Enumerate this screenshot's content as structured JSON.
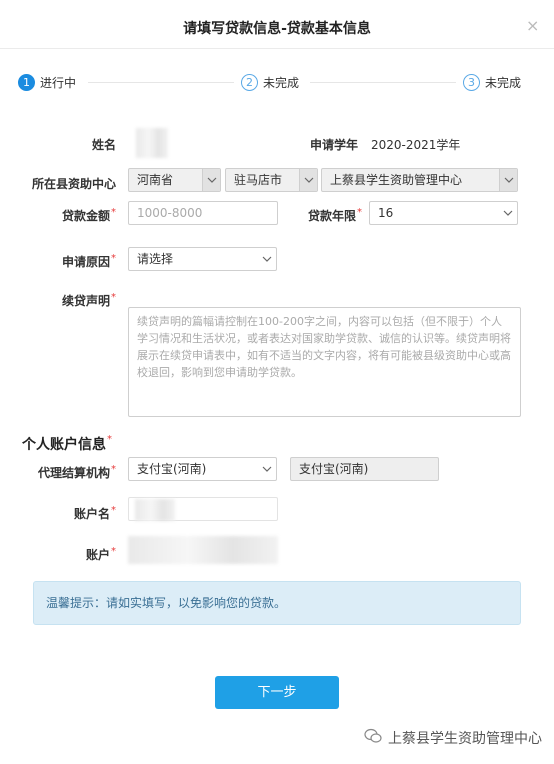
{
  "dialog": {
    "title": "请填写贷款信息-贷款基本信息",
    "close_symbol": "×"
  },
  "steps": [
    {
      "num": "1",
      "label": "进行中"
    },
    {
      "num": "2",
      "label": "未完成"
    },
    {
      "num": "3",
      "label": "未完成"
    }
  ],
  "form": {
    "name_label": "姓名",
    "year_label": "申请学年",
    "year_value": "2020-2021学年",
    "center_label": "所在县资助中心",
    "province": "河南省",
    "city": "驻马店市",
    "center": "上蔡县学生资助管理中心",
    "amount_label": "贷款金额",
    "amount_placeholder": "1000-8000",
    "term_label": "贷款年限",
    "term_value": "16",
    "reason_label": "申请原因",
    "reason_value": "请选择",
    "statement_label": "续贷声明",
    "statement_placeholder": "续贷声明的篇幅请控制在100-200字之间，内容可以包括（但不限于）个人学习情况和生活状况，或者表达对国家助学贷款、诚信的认识等。续贷声明将展示在续贷申请表中，如有不适当的文字内容，将有可能被县级资助中心或高校退回，影响到您申请助学贷款。",
    "required_mark": "*"
  },
  "account": {
    "section_title": "个人账户信息",
    "agency_label": "代理结算机构",
    "agency_value": "支付宝(河南)",
    "agency_display": "支付宝(河南)",
    "account_name_label": "账户名",
    "account_label": "账户"
  },
  "tip": {
    "text": "温馨提示：请如实填写，以免影响您的贷款。"
  },
  "buttons": {
    "next": "下一步"
  },
  "watermark": {
    "text": "上蔡县学生资助管理中心"
  },
  "colors": {
    "primary": "#1fa0e6",
    "required": "#e63b3b",
    "tip_bg": "#dcedf7"
  }
}
